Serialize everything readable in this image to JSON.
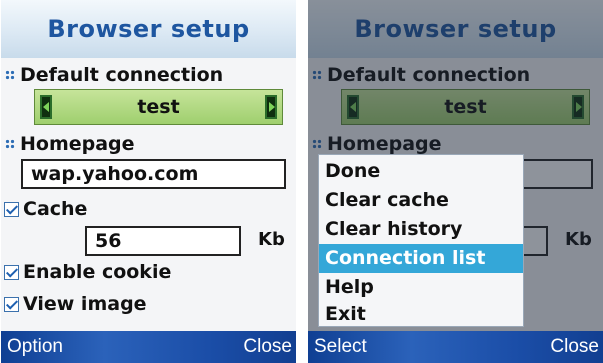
{
  "screens": [
    {
      "title": "Browser setup",
      "default_connection": {
        "label": "Default connection",
        "value": "test"
      },
      "homepage": {
        "label": "Homepage",
        "value": "wap.yahoo.com"
      },
      "cache": {
        "label": "Cache",
        "checked": true,
        "value": "56",
        "unit": "Kb"
      },
      "enable_cookie": {
        "label": "Enable cookie",
        "checked": true
      },
      "view_image": {
        "label": "View image",
        "checked": true
      },
      "softkeys": {
        "left": "Option",
        "right": "Close"
      }
    },
    {
      "title": "Browser setup",
      "default_connection": {
        "label": "Default connection",
        "value": "test"
      },
      "homepage": {
        "label": "Homepage"
      },
      "cache": {
        "unit": "Kb"
      },
      "menu": {
        "items": [
          "Done",
          "Clear cache",
          "Clear history",
          "Connection list",
          "Help",
          "Exit"
        ],
        "highlighted_index": 3
      },
      "softkeys": {
        "left": "Select",
        "right": "Close"
      }
    }
  ],
  "colors": {
    "title_text": "#1e56a0",
    "selector_green": "#9fcf6e",
    "softkey_bar": "#1b4ea8",
    "menu_highlight": "#34a7d8"
  }
}
